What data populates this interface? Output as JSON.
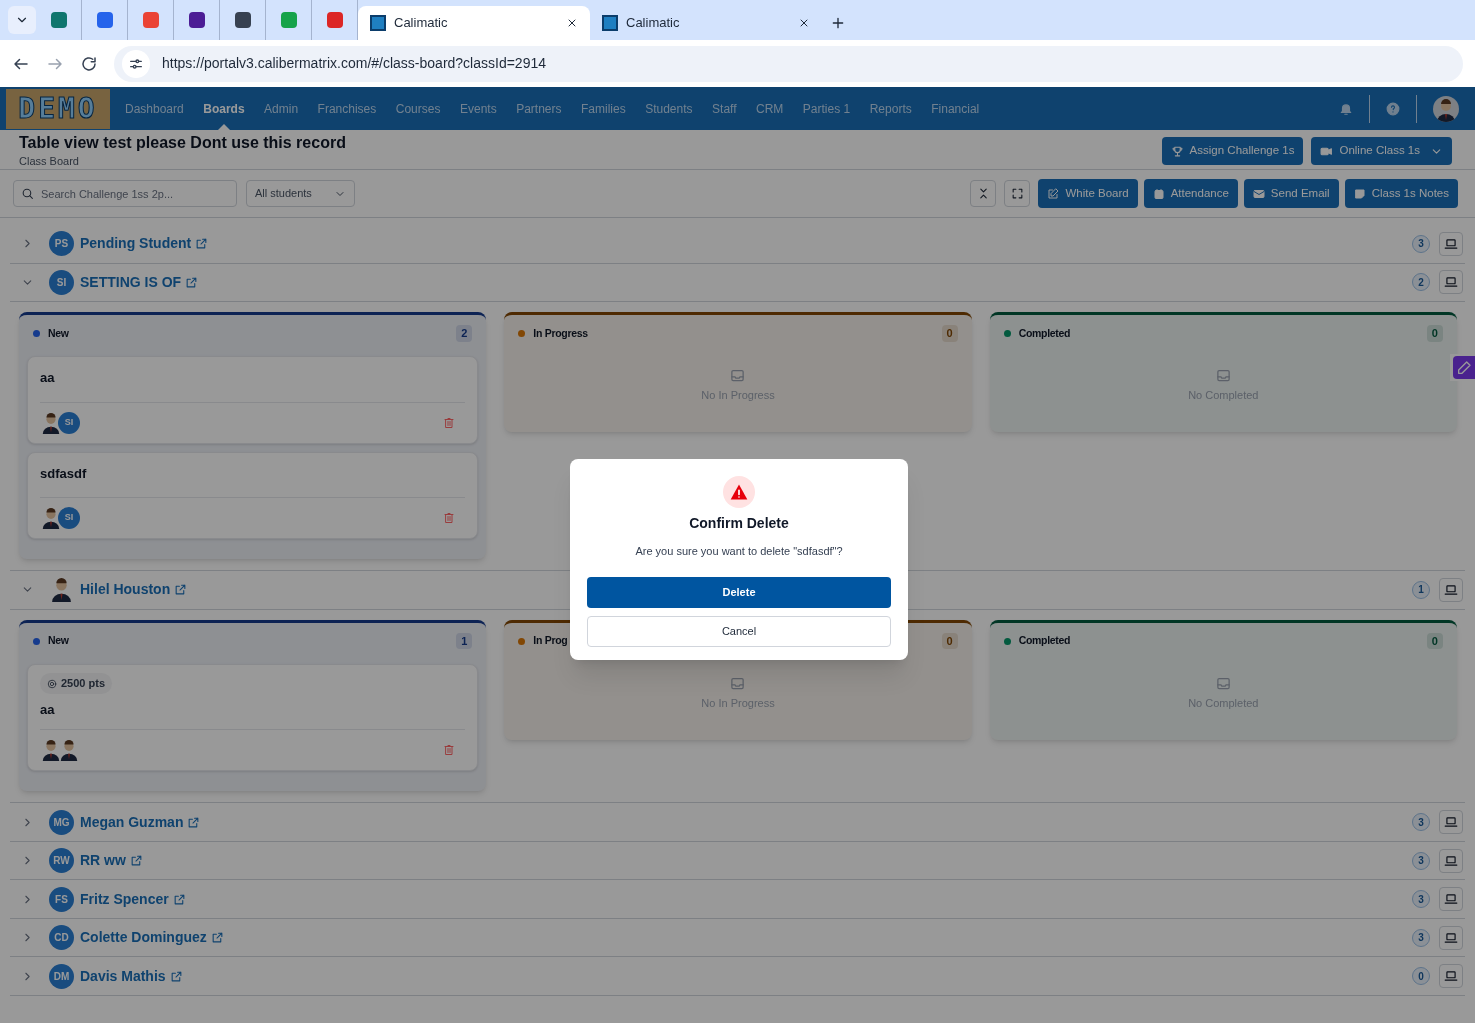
{
  "browser": {
    "tabs": [
      {
        "title": "Calimatic",
        "selected": true
      },
      {
        "title": "Calimatic",
        "selected": false
      }
    ],
    "url": "https://portalv3.calibermatrix.com/#/class-board?classId=2914"
  },
  "nav": {
    "logo": "DEMO",
    "items": [
      {
        "label": "Dashboard",
        "selected": false
      },
      {
        "label": "Boards",
        "selected": true
      },
      {
        "label": "Admin",
        "selected": false
      },
      {
        "label": "Franchises",
        "selected": false
      },
      {
        "label": "Courses",
        "selected": false
      },
      {
        "label": "Events",
        "selected": false
      },
      {
        "label": "Partners",
        "selected": false
      },
      {
        "label": "Families",
        "selected": false
      },
      {
        "label": "Students",
        "selected": false
      },
      {
        "label": "Staff",
        "selected": false
      },
      {
        "label": "CRM",
        "selected": false
      },
      {
        "label": "Parties 1",
        "selected": false
      },
      {
        "label": "Reports",
        "selected": false
      },
      {
        "label": "Financial",
        "selected": false
      }
    ]
  },
  "header": {
    "title": "Table view test please Dont use this record",
    "subtitle": "Class Board",
    "actions": [
      {
        "label": "Assign Challenge 1s",
        "kind": "trophy"
      },
      {
        "label": "Online Class 1s",
        "kind": "video"
      }
    ]
  },
  "toolbar": {
    "search": {
      "placeholder": "Search Challenge 1ss 2p..."
    },
    "filter": "All students",
    "buttons": [
      {
        "label": "White Board",
        "kind": "edit"
      },
      {
        "label": "Attendance",
        "kind": "calendar"
      },
      {
        "label": "Send Email",
        "kind": "mail"
      },
      {
        "label": "Class 1s Notes",
        "kind": "note"
      }
    ]
  },
  "students": [
    {
      "name": "Pending Student",
      "avatar": {
        "kind": "initials",
        "initials": "PS"
      },
      "count": "3",
      "expanded": false
    },
    {
      "name": "SETTING IS OF",
      "avatar": {
        "kind": "initials",
        "initials": "SI"
      },
      "count": "2",
      "expanded": true,
      "columns": [
        {
          "title": "New",
          "count": "2",
          "color": "#163b8d",
          "cards": [
            {
              "title": "aa",
              "avatars": [
                {
                  "kind": "picture"
                },
                {
                  "kind": "initials",
                  "initials": "SI"
                }
              ]
            },
            {
              "title": "sdfasdf",
              "avatars": [
                {
                  "kind": "picture"
                },
                {
                  "kind": "initials",
                  "initials": "SI"
                }
              ]
            }
          ]
        },
        {
          "title": "In Progress",
          "count": "0",
          "color": "#824704",
          "empty": "No In Progress"
        },
        {
          "title": "Completed",
          "count": "0",
          "color": "#035a3f",
          "empty": "No Completed"
        }
      ]
    },
    {
      "name": "Hilel Houston",
      "avatar": {
        "kind": "picture"
      },
      "count": "1",
      "expanded": true,
      "columns": [
        {
          "title": "New",
          "count": "1",
          "color": "#163b8d",
          "cards": [
            {
              "points": "2500 pts",
              "title": "aa",
              "avatars": [
                {
                  "kind": "picture"
                },
                {
                  "kind": "picture"
                }
              ]
            }
          ]
        },
        {
          "title": "In Prog",
          "count": "0",
          "color": "#824704",
          "empty": "No In Progress"
        },
        {
          "title": "Completed",
          "count": "0",
          "color": "#035a3f",
          "empty": "No Completed"
        }
      ]
    },
    {
      "name": "Megan Guzman",
      "avatar": {
        "kind": "initials",
        "initials": "MG"
      },
      "count": "3",
      "expanded": false
    },
    {
      "name": "RR ww",
      "avatar": {
        "kind": "initials",
        "initials": "RW"
      },
      "count": "3",
      "expanded": false
    },
    {
      "name": "Fritz Spencer",
      "avatar": {
        "kind": "initials",
        "initials": "FS"
      },
      "count": "3",
      "expanded": false
    },
    {
      "name": "Colette Dominguez",
      "avatar": {
        "kind": "initials",
        "initials": "CD"
      },
      "count": "3",
      "expanded": false
    },
    {
      "name": "Davis Mathis",
      "avatar": {
        "kind": "initials",
        "initials": "DM"
      },
      "count": "0",
      "expanded": false
    }
  ],
  "dialog": {
    "title": "Confirm Delete",
    "message": "Are you sure you want to delete \"sdfasdf\"?",
    "confirm": "Delete",
    "cancel": "Cancel"
  }
}
